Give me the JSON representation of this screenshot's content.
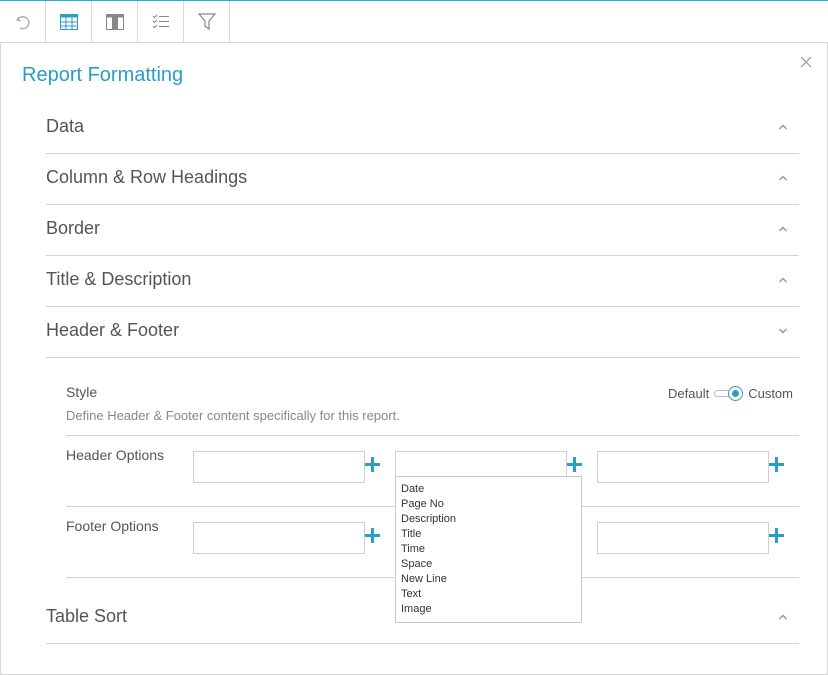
{
  "toolbar": {
    "items": [
      {
        "icon": "undo-icon"
      },
      {
        "icon": "table-icon"
      },
      {
        "icon": "columns-icon"
      },
      {
        "icon": "checklist-icon"
      },
      {
        "icon": "filter-icon"
      }
    ]
  },
  "panel": {
    "title": "Report Formatting",
    "close_icon": "close-icon"
  },
  "sections": [
    {
      "label": "Data",
      "state": "collapsed"
    },
    {
      "label": "Column & Row Headings",
      "state": "collapsed"
    },
    {
      "label": "Border",
      "state": "collapsed"
    },
    {
      "label": "Title & Description",
      "state": "collapsed"
    },
    {
      "label": "Header & Footer",
      "state": "expanded"
    },
    {
      "label": "Table Sort",
      "state": "collapsed"
    }
  ],
  "header_footer": {
    "style_label": "Style",
    "style_description": "Define Header & Footer content specifically for this report.",
    "toggle": {
      "left": "Default",
      "right": "Custom",
      "selected": "Custom"
    },
    "header_label": "Header Options",
    "footer_label": "Footer Options",
    "header_values": [
      "",
      "",
      ""
    ],
    "footer_values": [
      "",
      "",
      ""
    ]
  },
  "dropdown": {
    "options": [
      "Date",
      "Page No",
      "Description",
      "Title",
      "Time",
      "Space",
      "New Line",
      "Text",
      "Image"
    ]
  },
  "colors": {
    "accent": "#2a9ec4",
    "text": "#555555",
    "divider": "#d2d2d2"
  }
}
